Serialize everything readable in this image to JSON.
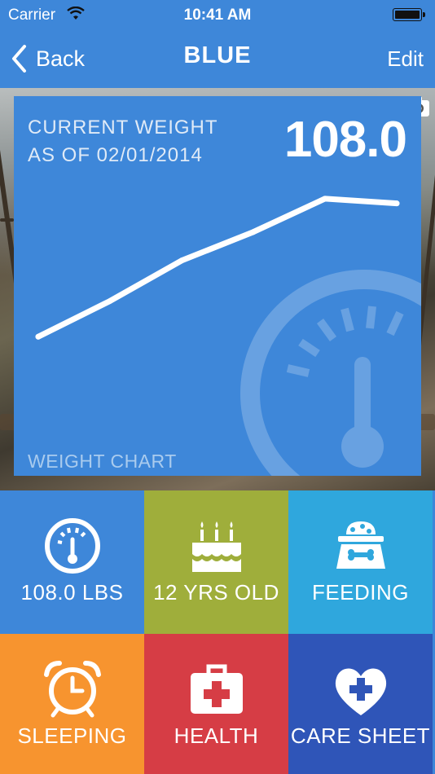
{
  "status_bar": {
    "carrier": "Carrier",
    "time": "10:41 AM"
  },
  "nav": {
    "back_label": "Back",
    "title": "BLUE",
    "edit_label": "Edit"
  },
  "weight_card": {
    "current_weight_line1": "CURRENT WEIGHT",
    "current_weight_line2": "AS OF 02/01/2014",
    "value": "108.0",
    "footer": "WEIGHT CHART"
  },
  "chart_data": {
    "type": "line",
    "title": "",
    "xlabel": "",
    "ylabel": "",
    "series": [
      {
        "values": [
          42,
          57,
          74,
          86,
          100,
          98
        ]
      }
    ],
    "ylim": [
      0,
      115
    ]
  },
  "tiles": [
    {
      "label": "108.0 LBS",
      "icon": "scale-gauge-icon",
      "color": "#3e87d9"
    },
    {
      "label": "12 YRS OLD",
      "icon": "birthday-cake-icon",
      "color": "#9fae3b"
    },
    {
      "label": "FEEDING",
      "icon": "food-bowl-icon",
      "color": "#2fa7dd"
    },
    {
      "label": "SLEEPING",
      "icon": "alarm-clock-icon",
      "color": "#f7942f"
    },
    {
      "label": "HEALTH",
      "icon": "first-aid-kit-icon",
      "color": "#d63d45"
    },
    {
      "label": "CARE SHEET",
      "icon": "heart-plus-icon",
      "color": "#2f55b8"
    }
  ],
  "colors": {
    "accent": "#3e87d9"
  }
}
